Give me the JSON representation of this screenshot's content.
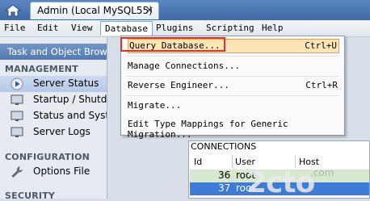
{
  "tabbar": {
    "tab_title": "Admin (Local MySQL55)",
    "close_glyph": "×",
    "home_icon": "home-icon"
  },
  "menubar": {
    "items": [
      "File",
      "Edit",
      "View",
      "Database",
      "Plugins",
      "Scripting",
      "Help"
    ]
  },
  "sidebar": {
    "header": "Task and Object Browser",
    "sections": [
      "MANAGEMENT",
      "CONFIGURATION",
      "SECURITY"
    ],
    "items": [
      {
        "label": "Server Status",
        "icon": "play-circle-icon"
      },
      {
        "label": "Startup / Shutdown",
        "icon": "monitor-icon"
      },
      {
        "label": "Status and System Variables",
        "icon": "monitor-icon"
      },
      {
        "label": "Server Logs",
        "icon": "monitor-icon"
      },
      {
        "label": "Options File",
        "icon": "wrench-icon"
      }
    ]
  },
  "database_menu": {
    "items": [
      {
        "label": "Query Database...",
        "shortcut": "Ctrl+U"
      },
      {
        "label": "Manage Connections...",
        "shortcut": ""
      },
      {
        "label": "Reverse Engineer...",
        "shortcut": "Ctrl+R"
      },
      {
        "label": "Migrate...",
        "shortcut": ""
      },
      {
        "label": "Edit Type Mappings for Generic Migration...",
        "shortcut": ""
      }
    ]
  },
  "connections": {
    "title": "CONNECTIONS",
    "columns": [
      "Id",
      "User",
      "Host"
    ],
    "rows": [
      {
        "id": "36",
        "user": "root"
      },
      {
        "id": "37",
        "user": "root"
      }
    ]
  },
  "watermark": {
    "text": "2cto",
    "sub": ".com"
  },
  "colors": {
    "accent": "#3f6aa5",
    "selection": "#3d7bd6",
    "highlight_border": "#e03030"
  }
}
